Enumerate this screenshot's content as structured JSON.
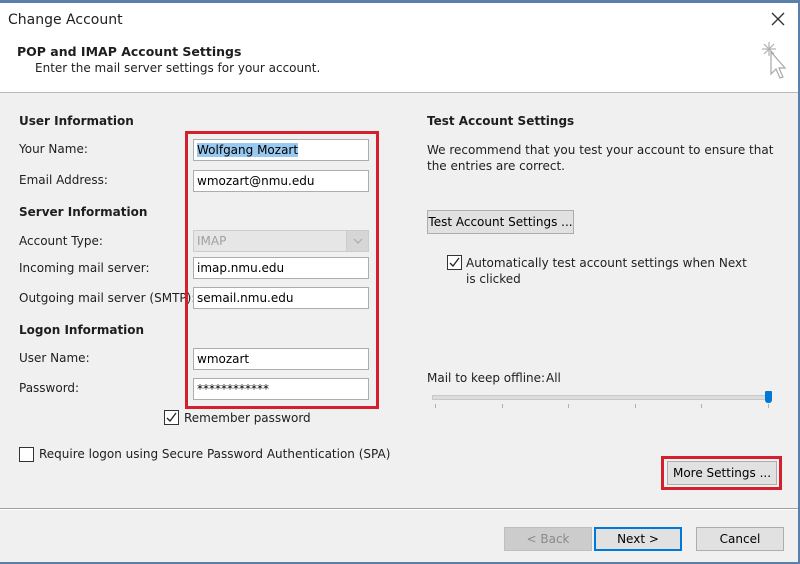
{
  "window": {
    "title": "Change Account",
    "close_icon": "close-icon"
  },
  "header": {
    "title": "POP and IMAP Account Settings",
    "subtitle": "Enter the mail server settings for your account.",
    "icon": "wizard-cursor-icon"
  },
  "user_information": {
    "heading": "User Information",
    "your_name_label": "Your Name:",
    "your_name_value": "Wolfgang Mozart",
    "email_label": "Email Address:",
    "email_value": "wmozart@nmu.edu"
  },
  "server_information": {
    "heading": "Server Information",
    "account_type_label": "Account Type:",
    "account_type_value": "IMAP",
    "incoming_label": "Incoming mail server:",
    "incoming_value": "imap.nmu.edu",
    "outgoing_label": "Outgoing mail server (SMTP):",
    "outgoing_value": "semail.nmu.edu"
  },
  "logon_information": {
    "heading": "Logon Information",
    "username_label": "User Name:",
    "username_value": "wmozart",
    "password_label": "Password:",
    "password_value": "************",
    "remember_password_label": "Remember password",
    "remember_password_checked": true,
    "spa_label": "Require logon using Secure Password Authentication (SPA)",
    "spa_checked": false
  },
  "test_settings": {
    "heading": "Test Account Settings",
    "description": "We recommend that you test your account to ensure that the entries are correct.",
    "test_button": "Test Account Settings ...",
    "auto_test_label": "Automatically test account settings when Next is clicked",
    "auto_test_checked": true
  },
  "offline": {
    "label": "Mail to keep offline:",
    "value": "All",
    "slider_position_fraction": 1.0,
    "slider_ticks": 6
  },
  "more_settings_button": "More Settings ...",
  "footer": {
    "back": "< Back",
    "next": "Next >",
    "cancel": "Cancel"
  },
  "colors": {
    "highlight_box": "#d4202c",
    "accent": "#0078d7",
    "selection": "#99c9ef"
  }
}
